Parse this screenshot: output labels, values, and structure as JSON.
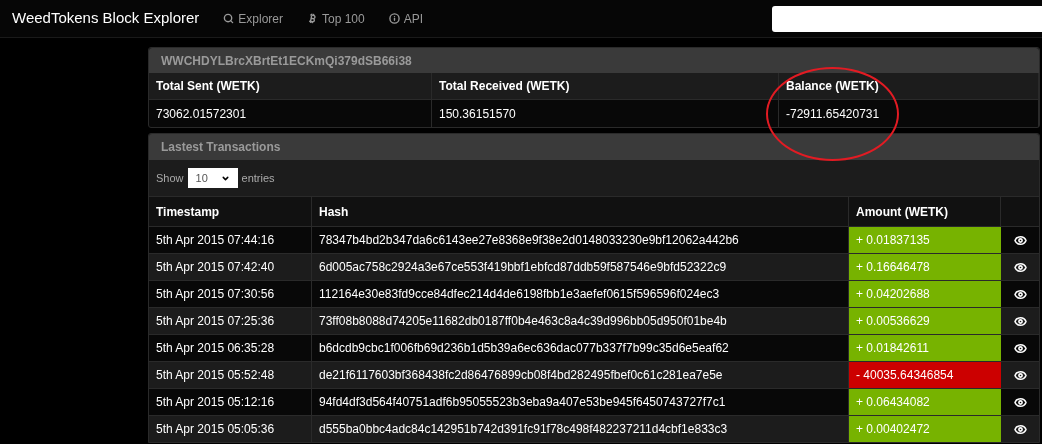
{
  "navbar": {
    "brand": "WeedTokens Block Explorer",
    "links": [
      {
        "label": "Explorer"
      },
      {
        "label": "Top 100"
      },
      {
        "label": "API"
      }
    ]
  },
  "address_panel": {
    "title": "WWCHDYLBrcXBrtEt1ECKmQi379dSB66i38",
    "columns": [
      {
        "heading": "Total Sent (WETK)",
        "value": "73062.01572301",
        "circled": false
      },
      {
        "heading": "Total Received (WETK)",
        "value": "150.36151570",
        "circled": false
      },
      {
        "heading": "Balance (WETK)",
        "value": "-72911.65420731",
        "circled": true
      }
    ]
  },
  "transactions_panel": {
    "title": "Lastest Transactions",
    "show_label": "Show",
    "page_size": "10",
    "entries_label": "entries",
    "columns": [
      "Timestamp",
      "Hash",
      "Amount (WETK)"
    ],
    "rows": [
      {
        "timestamp": "5th Apr 2015 07:44:16",
        "hash": "78347b4bd2b347da6c6143ee27e8368e9f38e2d0148033230e9bf12062a442b6",
        "amount": "+ 0.01837135",
        "kind": "credit"
      },
      {
        "timestamp": "5th Apr 2015 07:42:40",
        "hash": "6d005ac758c2924a3e67ce553f419bbf1ebfcd87ddb59f587546e9bfd52322c9",
        "amount": "+ 0.16646478",
        "kind": "credit"
      },
      {
        "timestamp": "5th Apr 2015 07:30:56",
        "hash": "112164e30e83fd9cce84dfec214d4de6198fbb1e3aefef0615f596596f024ec3",
        "amount": "+ 0.04202688",
        "kind": "credit"
      },
      {
        "timestamp": "5th Apr 2015 07:25:36",
        "hash": "73ff08b8088d74205e11682db0187ff0b4e463c8a4c39d996bb05d950f01be4b",
        "amount": "+ 0.00536629",
        "kind": "credit"
      },
      {
        "timestamp": "5th Apr 2015 06:35:28",
        "hash": "b6dcdb9cbc1f006fb69d236b1d5b39a6ec636dac077b337f7b99c35d6e5eaf62",
        "amount": "+ 0.01842611",
        "kind": "credit"
      },
      {
        "timestamp": "5th Apr 2015 05:52:48",
        "hash": "de21f6117603bf368438fc2d86476899cb08f4bd282495fbef0c61c281ea7e5e",
        "amount": "- 40035.64346854",
        "kind": "debit"
      },
      {
        "timestamp": "5th Apr 2015 05:12:16",
        "hash": "94fd4df3d564f40751adf6b95055523b3eba9a407e53be945f6450743727f7c1",
        "amount": "+ 0.06434082",
        "kind": "credit"
      },
      {
        "timestamp": "5th Apr 2015 05:05:36",
        "hash": "d555ba0bbc4adc84c142951b742d391fc91f78c498f482237211d4cbf1e833c3",
        "amount": "+ 0.00402472",
        "kind": "credit"
      }
    ]
  }
}
